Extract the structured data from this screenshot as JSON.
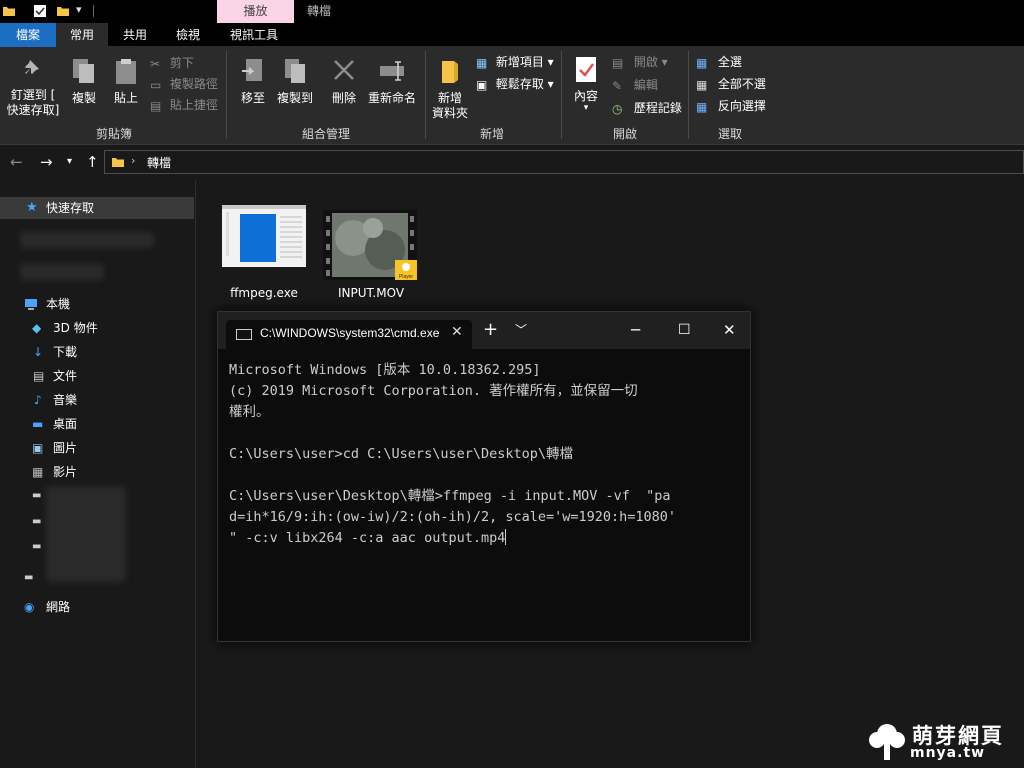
{
  "titlebar": {
    "contextual_tab": "播放",
    "window_title": "轉檔"
  },
  "ribbon_tabs": [
    "檔案",
    "常用",
    "共用",
    "檢視",
    "視訊工具"
  ],
  "ribbon": {
    "clipboard": {
      "pin_label_1": "釘選到 [",
      "pin_label_2": "快速存取]",
      "copy": "複製",
      "paste": "貼上",
      "cut": "剪下",
      "copy_path": "複製路徑",
      "paste_shortcut": "貼上捷徑",
      "group": "剪貼簿"
    },
    "organize": {
      "move_to": "移至",
      "copy_to": "複製到",
      "delete": "刪除",
      "rename": "重新命名",
      "group": "組合管理"
    },
    "new": {
      "new_folder_1": "新增",
      "new_folder_2": "資料夾",
      "new_item": "新增項目",
      "easy_access": "輕鬆存取",
      "group": "新增"
    },
    "open": {
      "properties": "內容",
      "open": "開啟",
      "edit": "編輯",
      "history": "歷程記錄",
      "group": "開啟"
    },
    "select": {
      "select_all": "全選",
      "select_none": "全部不選",
      "invert": "反向選擇",
      "group": "選取"
    }
  },
  "address": {
    "path": "轉檔"
  },
  "navpane": {
    "quick_access": "快速存取",
    "this_pc": "本機",
    "items": [
      "3D 物件",
      "下載",
      "文件",
      "音樂",
      "桌面",
      "圖片",
      "影片"
    ],
    "network": "網路"
  },
  "files": [
    {
      "name": "ffmpeg.exe",
      "badge": ""
    },
    {
      "name": "INPUT.MOV",
      "badge": "Player"
    }
  ],
  "cmd": {
    "tab_title": "C:\\WINDOWS\\system32\\cmd.exe",
    "lines": [
      "Microsoft Windows [版本 10.0.18362.295]",
      "(c) 2019 Microsoft Corporation. 著作權所有，並保留一切",
      "權利。",
      "",
      "C:\\Users\\user>cd C:\\Users\\user\\Desktop\\轉檔",
      "",
      "C:\\Users\\user\\Desktop\\轉檔>ffmpeg -i input.MOV -vf  \"pa",
      "d=ih*16/9:ih:(ow-iw)/2:(oh-ih)/2, scale='w=1920:h=1080'",
      "\" -c:v libx264 -c:a aac output.mp4"
    ]
  },
  "watermark": {
    "title": "萌芽網頁",
    "url": "mnya.tw"
  },
  "colors": {
    "accent": "#1b6ec2",
    "context_tab": "#f9d4e6",
    "folder": "#f4c54a",
    "ribbon_bg": "#2b2b2b"
  }
}
